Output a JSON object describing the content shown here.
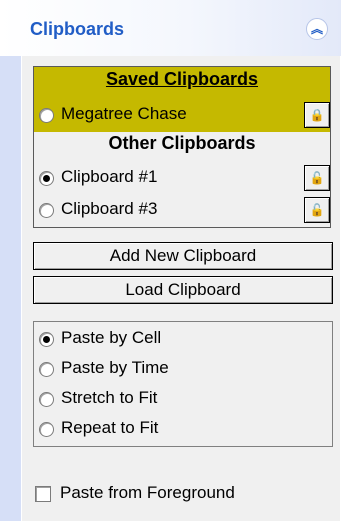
{
  "header": {
    "title": "Clipboards",
    "collapse_icon": "double-chevron-up-icon",
    "collapse_glyph": "︽"
  },
  "clipboards": {
    "saved_heading": "Saved Clipboards",
    "saved_items": [
      {
        "label": "Megatree Chase",
        "checked": false,
        "lock_icon": "lock-closed-icon",
        "lock_glyph": "🔒"
      }
    ],
    "other_heading": "Other Clipboards",
    "other_items": [
      {
        "label": "Clipboard #1",
        "checked": true,
        "lock_icon": "lock-open-icon",
        "lock_glyph": "🔓"
      },
      {
        "label": "Clipboard #3",
        "checked": false,
        "lock_icon": "lock-open-icon",
        "lock_glyph": "🔓"
      }
    ],
    "saved_highlight_color": "#c5b900"
  },
  "buttons": {
    "add_label": "Add New Clipboard",
    "load_label": "Load Clipboard"
  },
  "paste_options": {
    "items": [
      {
        "label": "Paste by Cell",
        "checked": true
      },
      {
        "label": "Paste by Time",
        "checked": false
      },
      {
        "label": "Stretch to Fit",
        "checked": false
      },
      {
        "label": "Repeat to Fit",
        "checked": false
      }
    ]
  },
  "foreground": {
    "label": "Paste from Foreground",
    "checked": false
  },
  "colors": {
    "header_title": "#215dc6",
    "sidebar_bg": "#d6dff7",
    "panel_bg": "#f0f0f0"
  }
}
